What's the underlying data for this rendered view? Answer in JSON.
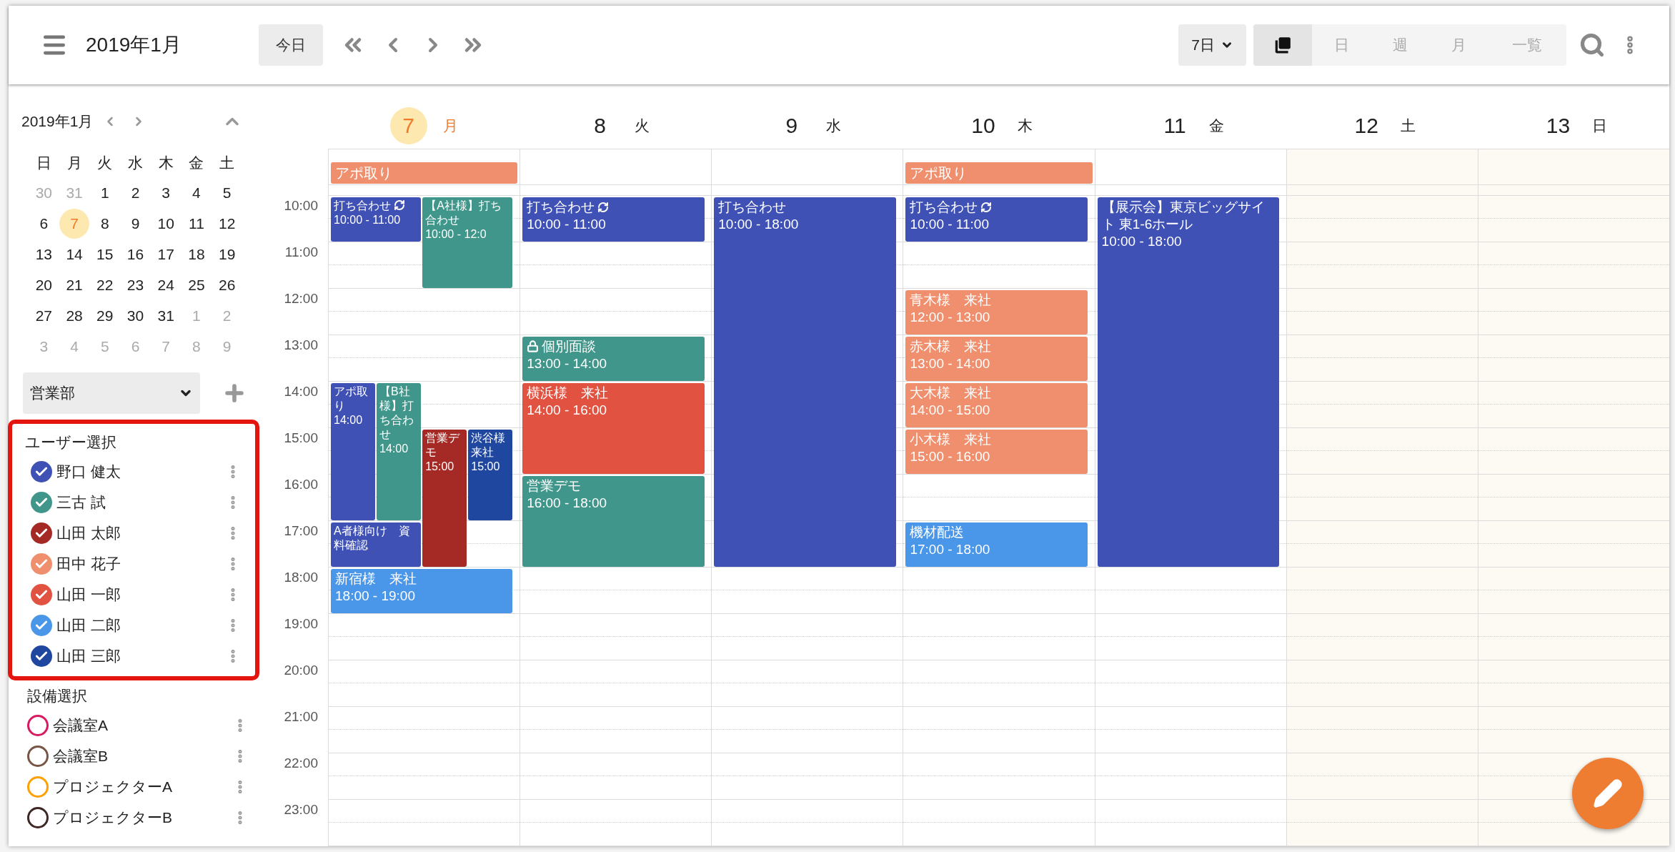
{
  "toolbar": {
    "title": "2019年1月",
    "today_button": "今日",
    "range_select": "7日",
    "views": [
      {
        "kind": "icon",
        "selected": true
      },
      {
        "kind": "text",
        "label": "日",
        "selected": false
      },
      {
        "kind": "text",
        "label": "週",
        "selected": false
      },
      {
        "kind": "text",
        "label": "月",
        "selected": false
      },
      {
        "kind": "text",
        "label": "一覧",
        "selected": false
      }
    ]
  },
  "mini_calendar": {
    "title": "2019年1月",
    "weekdays": [
      "日",
      "月",
      "火",
      "水",
      "木",
      "金",
      "土"
    ],
    "weeks": [
      {
        "days": [
          {
            "label": "30",
            "outside": true,
            "today": false
          },
          {
            "label": "31",
            "outside": true,
            "today": false
          },
          {
            "label": "1",
            "outside": false,
            "today": false
          },
          {
            "label": "2",
            "outside": false,
            "today": false
          },
          {
            "label": "3",
            "outside": false,
            "today": false
          },
          {
            "label": "4",
            "outside": false,
            "today": false
          },
          {
            "label": "5",
            "outside": false,
            "today": false
          }
        ]
      },
      {
        "days": [
          {
            "label": "6",
            "outside": false,
            "today": false
          },
          {
            "label": "7",
            "outside": false,
            "today": true
          },
          {
            "label": "8",
            "outside": false,
            "today": false
          },
          {
            "label": "9",
            "outside": false,
            "today": false
          },
          {
            "label": "10",
            "outside": false,
            "today": false
          },
          {
            "label": "11",
            "outside": false,
            "today": false
          },
          {
            "label": "12",
            "outside": false,
            "today": false
          }
        ]
      },
      {
        "days": [
          {
            "label": "13",
            "outside": false,
            "today": false
          },
          {
            "label": "14",
            "outside": false,
            "today": false
          },
          {
            "label": "15",
            "outside": false,
            "today": false
          },
          {
            "label": "16",
            "outside": false,
            "today": false
          },
          {
            "label": "17",
            "outside": false,
            "today": false
          },
          {
            "label": "18",
            "outside": false,
            "today": false
          },
          {
            "label": "19",
            "outside": false,
            "today": false
          }
        ]
      },
      {
        "days": [
          {
            "label": "20",
            "outside": false,
            "today": false
          },
          {
            "label": "21",
            "outside": false,
            "today": false
          },
          {
            "label": "22",
            "outside": false,
            "today": false
          },
          {
            "label": "23",
            "outside": false,
            "today": false
          },
          {
            "label": "24",
            "outside": false,
            "today": false
          },
          {
            "label": "25",
            "outside": false,
            "today": false
          },
          {
            "label": "26",
            "outside": false,
            "today": false
          }
        ]
      },
      {
        "days": [
          {
            "label": "27",
            "outside": false,
            "today": false
          },
          {
            "label": "28",
            "outside": false,
            "today": false
          },
          {
            "label": "29",
            "outside": false,
            "today": false
          },
          {
            "label": "30",
            "outside": false,
            "today": false
          },
          {
            "label": "31",
            "outside": false,
            "today": false
          },
          {
            "label": "1",
            "outside": true,
            "today": false
          },
          {
            "label": "2",
            "outside": true,
            "today": false
          }
        ]
      },
      {
        "days": [
          {
            "label": "3",
            "outside": true,
            "today": false
          },
          {
            "label": "4",
            "outside": true,
            "today": false
          },
          {
            "label": "5",
            "outside": true,
            "today": false
          },
          {
            "label": "6",
            "outside": true,
            "today": false
          },
          {
            "label": "7",
            "outside": true,
            "today": false
          },
          {
            "label": "8",
            "outside": true,
            "today": false
          },
          {
            "label": "9",
            "outside": true,
            "today": false
          }
        ]
      }
    ]
  },
  "department_select": "営業部",
  "users": {
    "heading": "ユーザー選択",
    "items": [
      {
        "name": "野口 健太",
        "color": "#3f51b5",
        "checked": true
      },
      {
        "name": "三古 試",
        "color": "#40968a",
        "checked": true
      },
      {
        "name": "山田 太郎",
        "color": "#a52a25",
        "checked": true
      },
      {
        "name": "田中 花子",
        "color": "#ef8f6d",
        "checked": true
      },
      {
        "name": "山田 一郎",
        "color": "#e15241",
        "checked": true
      },
      {
        "name": "山田 二郎",
        "color": "#4a97e9",
        "checked": true
      },
      {
        "name": "山田 三郎",
        "color": "#1f47a0",
        "checked": true
      }
    ]
  },
  "equipment": {
    "heading": "設備選択",
    "items": [
      {
        "name": "会議室A",
        "color": "#d81b60",
        "checked": false
      },
      {
        "name": "会議室B",
        "color": "#795548",
        "checked": false
      },
      {
        "name": "プロジェクターA",
        "color": "#ffa000",
        "checked": false
      },
      {
        "name": "プロジェクターB",
        "color": "#3e2723",
        "checked": false
      }
    ]
  },
  "hours": [
    "10:00",
    "11:00",
    "12:00",
    "13:00",
    "14:00",
    "15:00",
    "16:00",
    "17:00",
    "18:00",
    "19:00",
    "20:00",
    "21:00",
    "22:00",
    "23:00"
  ],
  "days": [
    {
      "date": "7",
      "weekday": "月",
      "today": true,
      "weekend": false,
      "all_day": [
        {
          "title": "アポ取り",
          "color": "#ef8f6d"
        }
      ],
      "events": [
        {
          "kind": "sync",
          "title": "打ち合わせ",
          "time": "10:00 - 11:00",
          "color": "#3f51b5"
        },
        {
          "kind": "plain",
          "title": "【A社様】打ち合わせ",
          "time": "10:00 - 12:0",
          "color": "#40968a"
        },
        {
          "kind": "plain",
          "title": "アポ取り",
          "time": "14:00",
          "color": "#3f51b5"
        },
        {
          "kind": "plain",
          "title": "【B社様】打ち合わせ",
          "time": "14:00",
          "color": "#40968a"
        },
        {
          "kind": "plain",
          "title": "営業デモ",
          "time": "15:00",
          "color": "#a52a25"
        },
        {
          "kind": "plain",
          "title": "渋谷様来社",
          "time": "15:00",
          "color": "#1f47a0"
        },
        {
          "kind": "plain",
          "title": "A者様向け　資料確認",
          "color": "#3f51b5"
        },
        {
          "kind": "plain",
          "title": "新宿様　来社",
          "time": "18:00 - 19:00",
          "color": "#4a97e9"
        }
      ]
    },
    {
      "date": "8",
      "weekday": "火",
      "today": false,
      "weekend": false,
      "events": [
        {
          "kind": "sync",
          "title": "打ち合わせ",
          "time": "10:00 - 11:00",
          "color": "#3f51b5"
        },
        {
          "kind": "lock",
          "title": "個別面談",
          "time": "13:00 - 14:00",
          "color": "#40968a"
        },
        {
          "kind": "plain",
          "title": "横浜様　来社",
          "time": "14:00 - 16:00",
          "color": "#e15241"
        },
        {
          "kind": "plain",
          "title": "営業デモ",
          "time": "16:00 - 18:00",
          "color": "#40968a"
        }
      ]
    },
    {
      "date": "9",
      "weekday": "水",
      "today": false,
      "weekend": false,
      "events": [
        {
          "kind": "plain",
          "title": "打ち合わせ",
          "time": "10:00 - 18:00",
          "color": "#3f51b5"
        }
      ]
    },
    {
      "date": "10",
      "weekday": "木",
      "today": false,
      "weekend": false,
      "all_day": [
        {
          "title": "アポ取り",
          "color": "#ef8f6d"
        }
      ],
      "events": [
        {
          "kind": "sync",
          "title": "打ち合わせ",
          "time": "10:00 - 11:00",
          "color": "#3f51b5"
        },
        {
          "kind": "plain",
          "title": "青木様　来社",
          "time": "12:00 - 13:00",
          "color": "#ef8f6d"
        },
        {
          "kind": "plain",
          "title": "赤木様　来社",
          "time": "13:00 - 14:00",
          "color": "#ef8f6d"
        },
        {
          "kind": "plain",
          "title": "大木様　来社",
          "time": "14:00 - 15:00",
          "color": "#ef8f6d"
        },
        {
          "kind": "plain",
          "title": "小木様　来社",
          "time": "15:00 - 16:00",
          "color": "#ef8f6d"
        },
        {
          "kind": "plain",
          "title": "機材配送",
          "time": "17:00 - 18:00",
          "color": "#4a97e9"
        }
      ]
    },
    {
      "date": "11",
      "weekday": "金",
      "today": false,
      "weekend": false,
      "events": [
        {
          "kind": "plain",
          "title": "【展示会】東京ビッグサイト 東1-6ホール",
          "time": "10:00 - 18:00",
          "color": "#3f51b5"
        }
      ]
    },
    {
      "date": "12",
      "weekday": "土",
      "today": false,
      "weekend": true
    },
    {
      "date": "13",
      "weekday": "日",
      "today": false,
      "weekend": true
    }
  ]
}
